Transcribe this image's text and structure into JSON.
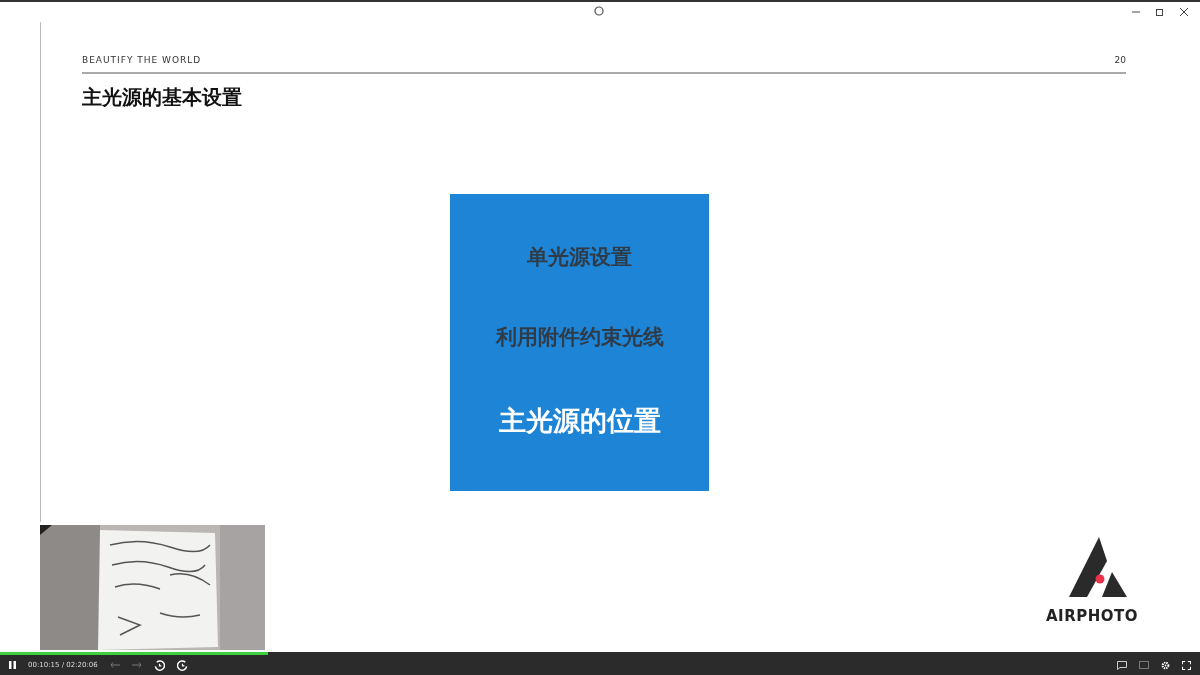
{
  "slide": {
    "header": "BEAUTIFY THE WORLD",
    "page_number": "20",
    "title": "主光源的基本设置",
    "menu_items": [
      {
        "label": "单光源设置",
        "selected": false
      },
      {
        "label": "利用附件约束光线",
        "selected": false
      },
      {
        "label": "主光源的位置",
        "selected": true
      }
    ],
    "logo_text": "AIRPHOTO"
  },
  "player": {
    "playing": true,
    "time": "00:10:15 / 02:20:06",
    "progress": {
      "level": 0.223
    }
  }
}
